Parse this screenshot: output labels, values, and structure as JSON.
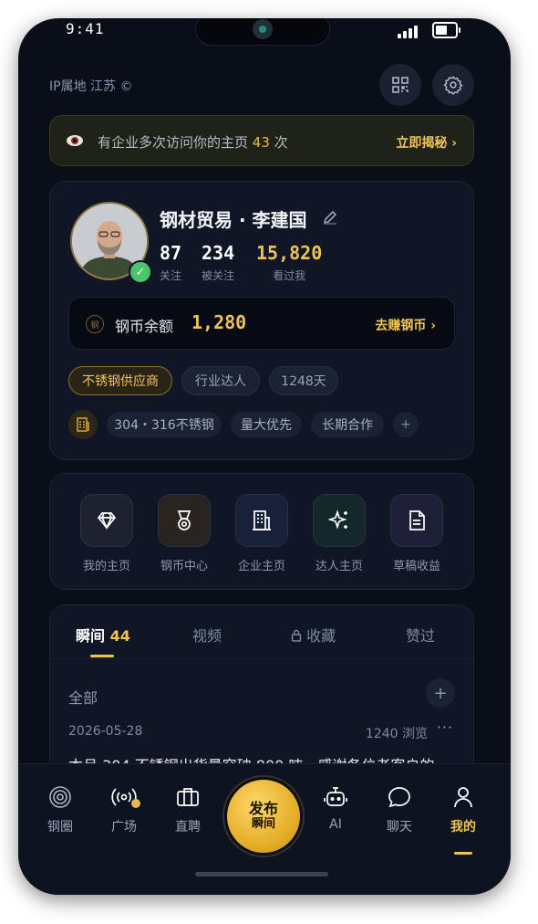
{
  "status": {
    "time": "9:41"
  },
  "header": {
    "ip_location": "IP属地 江苏 ©"
  },
  "icons": {
    "qr": "qr-code-icon",
    "settings": "gear-icon"
  },
  "banner": {
    "prefix": "有企业多次访问你的主页",
    "count": "43",
    "suffix": "次",
    "cta": "立即揭秘 ›"
  },
  "profile": {
    "name": "钢材贸易 · 李建国",
    "stats": [
      {
        "value": "87",
        "label": "关注"
      },
      {
        "value": "234",
        "label": "被关注"
      },
      {
        "value": "15,820",
        "label": "看过我"
      }
    ],
    "coin": {
      "icon_text": "钢",
      "label": "钢币余额",
      "value": "1,280",
      "cta": "去赚钢币 ›"
    },
    "tags": [
      "不锈钢供应商",
      "行业达人",
      "1248天"
    ],
    "business_tags": [
      "304・316不锈钢",
      "量大优先",
      "长期合作"
    ],
    "add_tag": "+"
  },
  "shortcuts": [
    {
      "label": "我的主页",
      "icon": "diamond-icon"
    },
    {
      "label": "钢币中心",
      "icon": "medal-icon"
    },
    {
      "label": "企业主页",
      "icon": "building-icon"
    },
    {
      "label": "达人主页",
      "icon": "sparkle-icon"
    },
    {
      "label": "草稿收益",
      "icon": "document-icon"
    }
  ],
  "posts": {
    "tabs": [
      {
        "label": "瞬间",
        "count": "44"
      },
      {
        "label": "视频"
      },
      {
        "label": "收藏"
      },
      {
        "label": "赞过"
      }
    ],
    "filter": "全部",
    "add": "+",
    "item": {
      "date": "2026-05-28",
      "views": "1240 浏览",
      "more": "···",
      "text": "本月 304 不锈钢出货量突破 800 吨，感谢各位老客户的"
    }
  },
  "nav": {
    "items": [
      {
        "label": "钢圈",
        "icon": "circles-icon"
      },
      {
        "label": "广场",
        "icon": "broadcast-icon"
      },
      {
        "label": "直聘",
        "icon": "briefcase-icon"
      },
      {
        "label": "AI",
        "icon": "robot-icon"
      },
      {
        "label": "聊天",
        "icon": "chat-icon"
      },
      {
        "label": "我的",
        "icon": "user-icon"
      }
    ],
    "publish_line1": "发布",
    "publish_line2": "瞬间"
  },
  "colors": {
    "accent": "#f0c257",
    "background": "#0a0e18",
    "card": "#101626",
    "verified": "#4bc46b"
  }
}
